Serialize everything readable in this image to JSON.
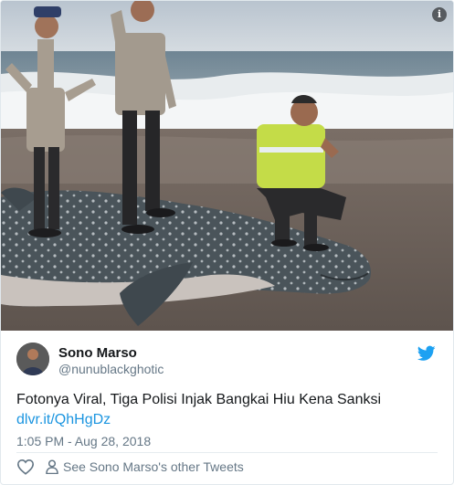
{
  "media": {
    "alt_icon": "info-icon",
    "info_glyph": "i",
    "description_icon": "photo"
  },
  "author": {
    "name": "Sono Marso",
    "handle": "@nunublackghotic",
    "avatar_icon": "avatar-photo"
  },
  "brand": {
    "icon": "twitter-bird-icon",
    "color": "#1da1f2"
  },
  "tweet": {
    "text": "Fotonya Viral, Tiga Polisi Injak Bangkai Hiu Kena Sanksi",
    "link": "dlvr.it/QhHgDz",
    "timestamp": "1:05 PM - Aug 28, 2018"
  },
  "actions": {
    "like_icon": "heart-icon",
    "other_tweets_icon": "person-icon",
    "other_tweets_label": "See Sono Marso's other Tweets"
  },
  "colors": {
    "link": "#1b95e0",
    "secondary_text": "#657786",
    "border": "#e1e8ed"
  }
}
